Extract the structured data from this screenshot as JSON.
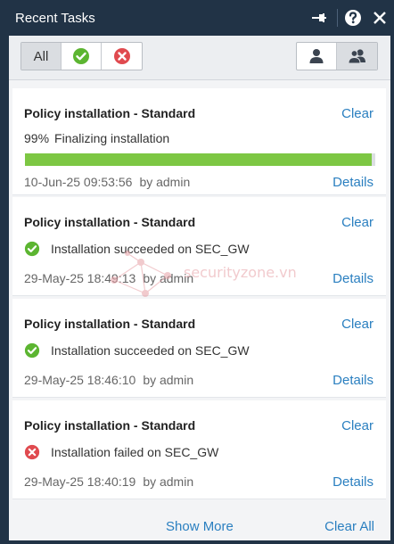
{
  "window": {
    "title": "Recent Tasks"
  },
  "filters": {
    "all_label": "All"
  },
  "tasks": [
    {
      "title": "Policy installation - Standard",
      "clear_label": "Clear",
      "percent_text": "99%",
      "status_text": "Finalizing installation",
      "progress": 0.99,
      "date": "10-Jun-25 09:53:56",
      "by": "by admin",
      "details_label": "Details"
    },
    {
      "title": "Policy installation - Standard",
      "clear_label": "Clear",
      "status_text": "Installation succeeded on SEC_GW",
      "status_icon": "success-check-icon",
      "date": "29-May-25 18:49:13",
      "by": "by admin",
      "details_label": "Details"
    },
    {
      "title": "Policy installation - Standard",
      "clear_label": "Clear",
      "status_text": "Installation succeeded on SEC_GW",
      "status_icon": "success-check-icon",
      "date": "29-May-25 18:46:10",
      "by": "by admin",
      "details_label": "Details"
    },
    {
      "title": "Policy installation - Standard",
      "clear_label": "Clear",
      "status_text": "Installation failed on SEC_GW",
      "status_icon": "error-x-icon",
      "date": "29-May-25 18:40:19",
      "by": "by admin",
      "details_label": "Details"
    }
  ],
  "footer": {
    "show_more_label": "Show More",
    "clear_all_label": "Clear All"
  },
  "watermark": {
    "text": "securityzone.vn"
  },
  "colors": {
    "title_bar": "#213346",
    "link": "#2a7fc0",
    "success": "#5cb531",
    "error": "#e04a4f",
    "progress": "#7dc743"
  }
}
